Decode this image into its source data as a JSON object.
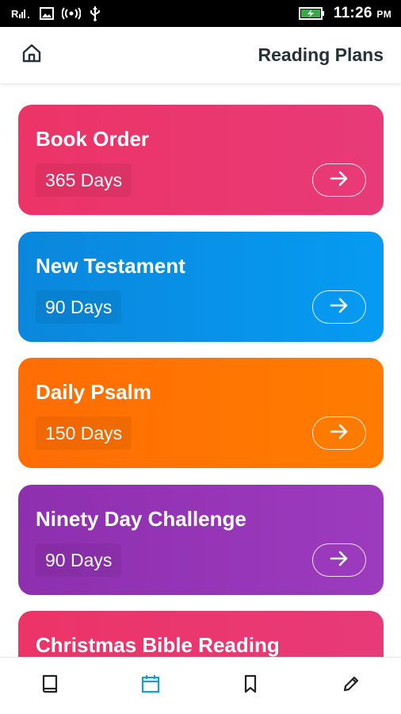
{
  "status_bar": {
    "time": "11:26",
    "ampm": "PM",
    "icons": [
      "signal-icon",
      "image-icon",
      "hotspot-icon",
      "usb-icon",
      "battery-charging-icon"
    ]
  },
  "header": {
    "title": "Reading Plans",
    "home_icon": "home-icon"
  },
  "plans": [
    {
      "title": "Book Order",
      "days": "365 Days",
      "color_from": "#ec3467",
      "color_to": "#e83a78"
    },
    {
      "title": "New Testament",
      "days": "90 Days",
      "color_from": "#0a87dc",
      "color_to": "#069bf3"
    },
    {
      "title": "Daily Psalm",
      "days": "150 Days",
      "color_from": "#ff6d04",
      "color_to": "#ff7c00"
    },
    {
      "title": "Ninety Day Challenge",
      "days": "90 Days",
      "color_from": "#8e2fb0",
      "color_to": "#9c3bbd"
    },
    {
      "title": "Christmas Bible Reading",
      "days": "",
      "color_from": "#ec3467",
      "color_to": "#e83a78"
    }
  ],
  "bottom_nav": {
    "items": [
      "book-icon",
      "calendar-icon",
      "bookmark-icon",
      "pencil-icon"
    ],
    "active": "calendar-icon",
    "active_color": "#1a9be0",
    "inactive_color": "#222222"
  }
}
